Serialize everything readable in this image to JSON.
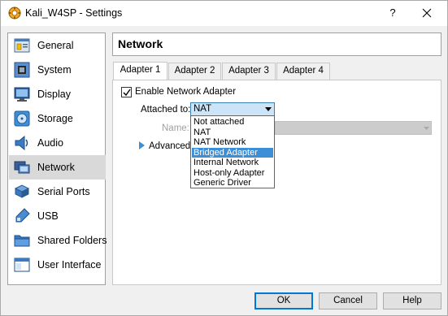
{
  "window": {
    "title": "Kali_W4SP - Settings",
    "help_glyph": "?",
    "close_glyph": "✕"
  },
  "sidebar": {
    "items": [
      {
        "label": "General",
        "icon": "general-icon"
      },
      {
        "label": "System",
        "icon": "system-icon"
      },
      {
        "label": "Display",
        "icon": "display-icon"
      },
      {
        "label": "Storage",
        "icon": "storage-icon"
      },
      {
        "label": "Audio",
        "icon": "audio-icon"
      },
      {
        "label": "Network",
        "icon": "network-icon",
        "active": true
      },
      {
        "label": "Serial Ports",
        "icon": "serial-ports-icon"
      },
      {
        "label": "USB",
        "icon": "usb-icon"
      },
      {
        "label": "Shared Folders",
        "icon": "shared-folders-icon"
      },
      {
        "label": "User Interface",
        "icon": "user-interface-icon"
      }
    ]
  },
  "section": {
    "title": "Network"
  },
  "tabs": [
    {
      "label": "Adapter 1",
      "active": true
    },
    {
      "label": "Adapter 2"
    },
    {
      "label": "Adapter 3"
    },
    {
      "label": "Adapter 4"
    }
  ],
  "adapter": {
    "enable_label": "Enable Network Adapter",
    "enabled": true,
    "attached_label": "Attached to:",
    "attached_value": "NAT",
    "name_label": "Name:",
    "name_value": "",
    "advanced_label": "Advanced"
  },
  "dropdown": {
    "options": [
      "Not attached",
      "NAT",
      "NAT Network",
      "Bridged Adapter",
      "Internal Network",
      "Host-only Adapter",
      "Generic Driver"
    ],
    "highlighted": "Bridged Adapter"
  },
  "buttons": {
    "ok": "OK",
    "cancel": "Cancel",
    "help": "Help"
  },
  "colors": {
    "accent": "#0078d7",
    "highlight": "#3c8fd6",
    "select_bg": "#cce4f7"
  }
}
